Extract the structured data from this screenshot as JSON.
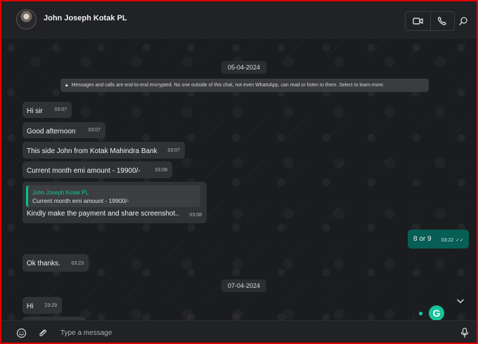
{
  "header": {
    "contact_name": "John Joseph Kotak PL"
  },
  "chat": {
    "dates": [
      "05-04-2024",
      "07-04-2024"
    ],
    "encryption_notice": "Messages and calls are end-to-end encrypted. No one outside of this chat, not even WhatsApp, can read or listen to them. Select to learn more.",
    "messages": [
      {
        "text": "Hi sir",
        "time": "03:07"
      },
      {
        "text": "Good afternoon",
        "time": "03:07"
      },
      {
        "text": "This side John from Kotak Mahindra Bank",
        "time": "03:07"
      },
      {
        "text": "Current month emi amount - 19900/-",
        "time": "03:08"
      },
      {
        "text": "Kindly make the payment and share screenshot..",
        "time": "03:08",
        "quoted_author": "John Joseph Kotak PL",
        "quoted_text": "Current month emi amount - 19900/-"
      },
      {
        "text": "8 or 9",
        "time": "03:22",
        "outgoing": true
      },
      {
        "text": "Ok thanks.",
        "time": "03:23"
      },
      {
        "text": "Hi",
        "time": "23:29"
      }
    ]
  },
  "footer": {
    "placeholder": "Type a message"
  },
  "colors": {
    "outgoing_bubble": "#075e54",
    "incoming_bubble": "#303236",
    "accent": "#15c39a"
  }
}
